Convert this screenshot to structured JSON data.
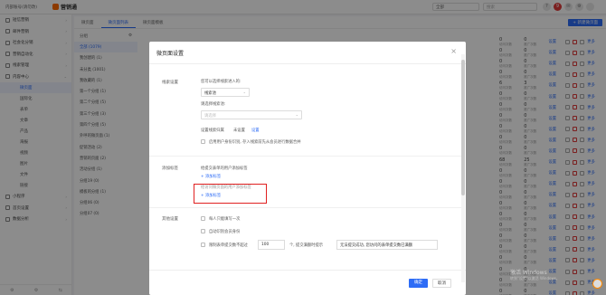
{
  "topbar": {
    "org": "内部账号(请勿改)",
    "brand": "营销通",
    "scope": "全部",
    "search_placeholder": "搜索",
    "badge": "9"
  },
  "sidebar": {
    "items": [
      {
        "label": "短信营销",
        "icon": "message-icon",
        "expanded": false
      },
      {
        "label": "邮件营销",
        "icon": "mail-icon",
        "expanded": false
      },
      {
        "label": "社会化分销",
        "icon": "share-icon",
        "expanded": false
      },
      {
        "label": "营销自动化",
        "icon": "flow-icon",
        "expanded": false
      },
      {
        "label": "线索管理",
        "icon": "funnel-icon",
        "expanded": false
      },
      {
        "label": "内容中心",
        "icon": "folder-icon",
        "expanded": true
      }
    ],
    "sub_items": [
      {
        "label": "微页面",
        "active": true
      },
      {
        "label": "国际化",
        "active": false
      },
      {
        "label": "表单",
        "active": false
      },
      {
        "label": "文章",
        "active": false
      },
      {
        "label": "产品",
        "active": false
      },
      {
        "label": "海报",
        "active": false
      },
      {
        "label": "视频",
        "active": false
      },
      {
        "label": "图片",
        "active": false
      },
      {
        "label": "文件",
        "active": false
      },
      {
        "label": "链接",
        "active": false
      }
    ],
    "more_items": [
      {
        "label": "小程序",
        "icon": "miniapp-icon"
      },
      {
        "label": "首页设置",
        "icon": "home-icon"
      },
      {
        "label": "数据分析",
        "icon": "chart-icon"
      }
    ]
  },
  "content": {
    "tabs": [
      "微页面",
      "微页面列表",
      "微页面模板"
    ],
    "active_tab": 1,
    "new_button": "+ 新建微页面",
    "category_header": "分组",
    "categories": [
      {
        "label": "全部 (1079)",
        "active": true
      },
      {
        "label": "我创建的 (1)"
      },
      {
        "label": "未分类 (1001)"
      },
      {
        "label": "我收藏的 (1)"
      },
      {
        "label": "第一个分组 (1)"
      },
      {
        "label": "第二个分组 (5)"
      },
      {
        "label": "第三个分组 (3)"
      },
      {
        "label": "第四个分组 (5)"
      },
      {
        "label": "外呼的微页面 (1)"
      },
      {
        "label": "促销活动 (2)"
      },
      {
        "label": "营销的页面 (2)"
      },
      {
        "label": "活动分组 (1)"
      },
      {
        "label": "分组19 (0)"
      },
      {
        "label": "模板的分组 (1)"
      },
      {
        "label": "分组06 (0)"
      },
      {
        "label": "分组07 (0)"
      }
    ],
    "table_head": [
      "访问",
      "推广",
      "操作",
      ""
    ],
    "rows": [
      {
        "a": "0",
        "a_sub": "访问次数",
        "b": "0",
        "b_sub": "推广次数",
        "action": "设置"
      },
      {
        "a": "0",
        "a_sub": "访问次数",
        "b": "0",
        "b_sub": "推广次数",
        "action": "设置"
      },
      {
        "a": "0",
        "a_sub": "访问次数",
        "b": "0",
        "b_sub": "推广次数",
        "action": "设置"
      },
      {
        "a": "0",
        "a_sub": "访问次数",
        "b": "0",
        "b_sub": "推广次数",
        "action": "设置"
      },
      {
        "a": "6",
        "a_sub": "访问次数",
        "b": "3",
        "b_sub": "推广次数",
        "action": "设置"
      },
      {
        "a": "0",
        "a_sub": "访问次数",
        "b": "0",
        "b_sub": "推广次数",
        "action": "设置"
      },
      {
        "a": "0",
        "a_sub": "访问次数",
        "b": "0",
        "b_sub": "推广次数",
        "action": "设置"
      },
      {
        "a": "0",
        "a_sub": "访问次数",
        "b": "0",
        "b_sub": "推广次数",
        "action": "设置"
      },
      {
        "a": "0",
        "a_sub": "访问次数",
        "b": "0",
        "b_sub": "推广次数",
        "action": "设置"
      },
      {
        "a": "0",
        "a_sub": "访问次数",
        "b": "0",
        "b_sub": "推广次数",
        "action": "设置"
      },
      {
        "a": "0",
        "a_sub": "访问次数",
        "b": "0",
        "b_sub": "推广次数",
        "action": "设置"
      },
      {
        "a": "68",
        "a_sub": "访问次数",
        "b": "25",
        "b_sub": "推广次数",
        "action": "设置"
      },
      {
        "a": "0",
        "a_sub": "访问次数",
        "b": "0",
        "b_sub": "推广次数",
        "action": "设置"
      },
      {
        "a": "0",
        "a_sub": "访问次数",
        "b": "0",
        "b_sub": "推广次数",
        "action": "设置"
      },
      {
        "a": "0",
        "a_sub": "访问次数",
        "b": "0",
        "b_sub": "推广次数",
        "action": "设置"
      },
      {
        "a": "0",
        "a_sub": "访问次数",
        "b": "0",
        "b_sub": "推广次数",
        "action": "设置"
      },
      {
        "a": "0",
        "a_sub": "访问次数",
        "b": "0",
        "b_sub": "推广次数",
        "action": "设置"
      },
      {
        "a": "0",
        "a_sub": "访问次数",
        "b": "0",
        "b_sub": "推广次数",
        "action": "设置"
      },
      {
        "a": "0",
        "a_sub": "访问次数",
        "b": "0",
        "b_sub": "推广次数",
        "action": "设置"
      },
      {
        "a": "0",
        "a_sub": "访问次数",
        "b": "0",
        "b_sub": "推广次数",
        "action": "设置"
      },
      {
        "a": "0",
        "a_sub": "访问次数",
        "b": "0",
        "b_sub": "推广次数",
        "action": "设置"
      },
      {
        "a": "0",
        "a_sub": "访问次数",
        "b": "0",
        "b_sub": "推广次数",
        "action": "设置"
      },
      {
        "a": "0",
        "a_sub": "访问次数",
        "b": "0",
        "b_sub": "推广次数",
        "action": "设置"
      },
      {
        "a": "0",
        "a_sub": "访问次数",
        "b": "0",
        "b_sub": "推广次数",
        "action": "设置"
      }
    ],
    "row_extra": "更多"
  },
  "modal": {
    "title": "微页面设置",
    "section_lead": {
      "label": "线索设置",
      "source_label": "您可以选择线索进入的:",
      "source_value": "线索池",
      "pool_label": "请选择线索池:",
      "pool_placeholder": "请选择",
      "default_owner_label": "设置线索归属",
      "default_owner_value": "未设置",
      "default_owner_link": "设置",
      "checkbox_label": "启用用户身份识别, 存入线索前先从会员进行数据合并"
    },
    "section_tag": {
      "label": "添加标签",
      "submit_tag_label": "给提交表单的用户添加标签",
      "submit_tag_add": "+ 添加标签",
      "visit_tag_label": "给访问微页面的用户添加标签",
      "visit_tag_add": "+ 添加标签"
    },
    "section_other": {
      "label": "其他设置",
      "opt1": "每人只能填写一次",
      "opt2": "自动识别会员身份",
      "opt3_prefix": "限制表单提交数不超过",
      "opt3_value": "100",
      "opt3_suffix": "个, 提交满额时提示",
      "opt3_msg": "无法提交成功, 您访问的表单提交数已满额"
    },
    "ok": "确定",
    "cancel": "取消"
  },
  "watermark": {
    "line1": "激活 Windows",
    "line2": "转到\"设置\"以激活 Windows。"
  },
  "colors": {
    "primary": "#2d6cf6",
    "highlight": "#e02020",
    "brand": "#ff6a00"
  }
}
